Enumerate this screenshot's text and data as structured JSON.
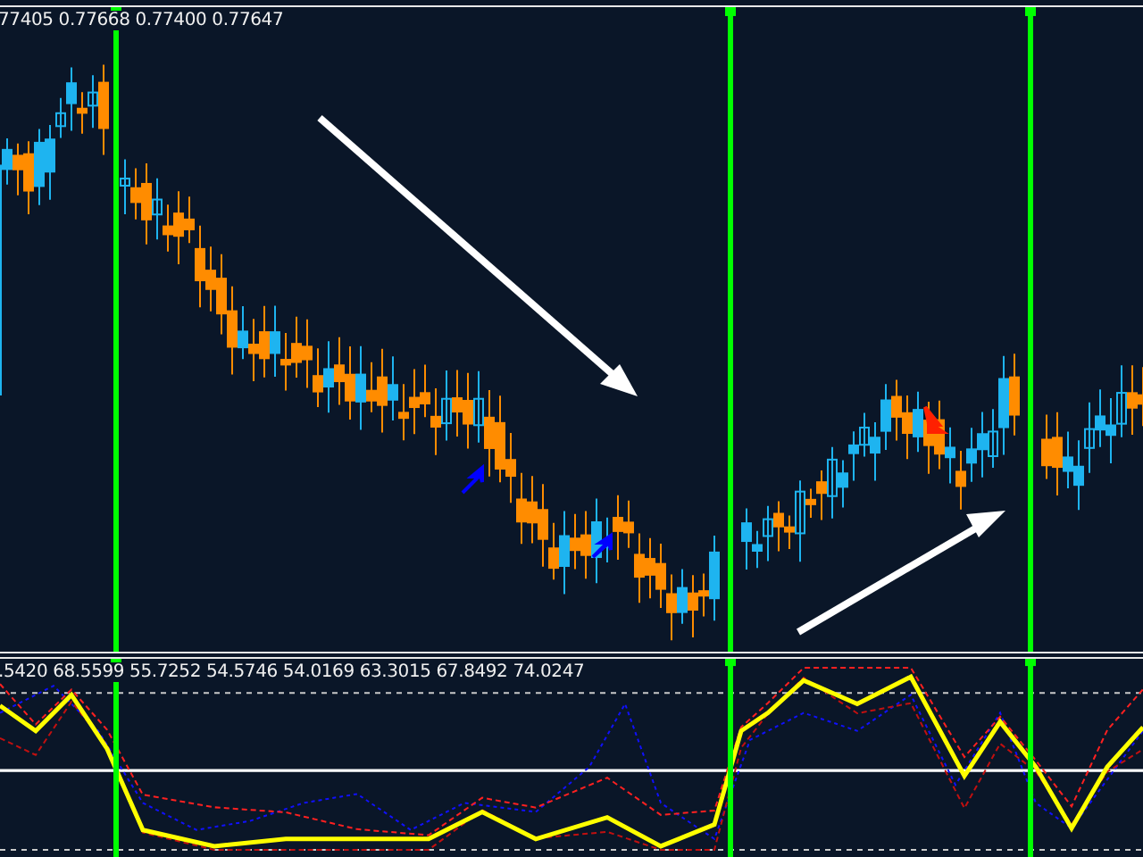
{
  "price_panel": {
    "ohlc_readout": "77405 0.77668 0.77400 0.77647"
  },
  "indicator_panel": {
    "values_readout": ".5420 68.5599 55.7252 54.5746 54.0169 63.3015 67.8492 74.0247"
  }
}
